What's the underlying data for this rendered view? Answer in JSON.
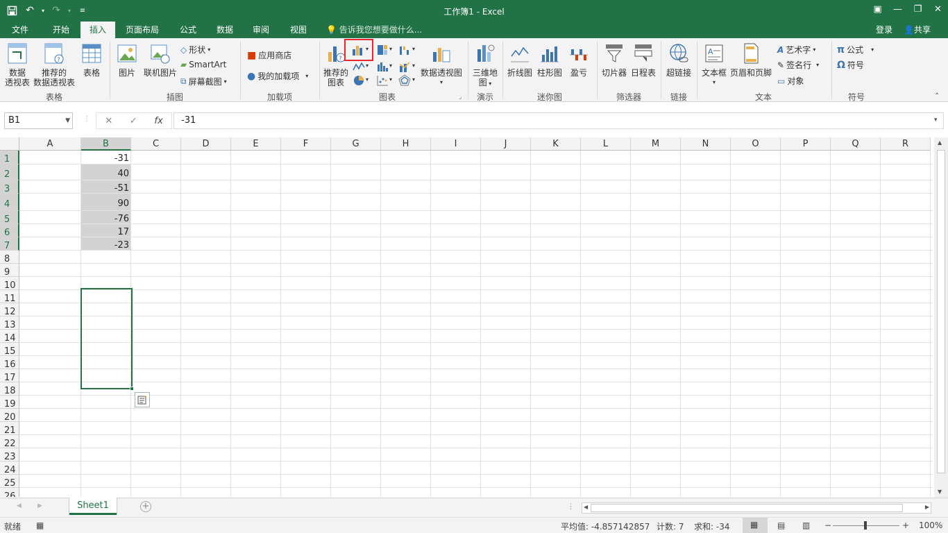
{
  "window": {
    "title": "工作簿1 - Excel"
  },
  "tabs": [
    {
      "label": "文件",
      "active": false
    },
    {
      "label": "开始",
      "active": false
    },
    {
      "label": "插入",
      "active": true
    },
    {
      "label": "页面布局",
      "active": false
    },
    {
      "label": "公式",
      "active": false
    },
    {
      "label": "数据",
      "active": false
    },
    {
      "label": "审阅",
      "active": false
    },
    {
      "label": "视图",
      "active": false
    }
  ],
  "tell_me": "告诉我您想要做什么...",
  "login": "登录",
  "share": "共享",
  "ribbon": {
    "pivot_line1": "数据",
    "pivot_line2": "透视表",
    "rec_pivot_line1": "推荐的",
    "rec_pivot_line2": "数据透视表",
    "table": "表格",
    "group_tables": "表格",
    "picture": "图片",
    "online_picture": "联机图片",
    "shapes": "形状",
    "smartart": "SmartArt",
    "screenshot": "屏幕截图",
    "group_illustrations": "插图",
    "store": "应用商店",
    "my_addins": "我的加载项",
    "group_addins": "加载项",
    "rec_chart_line1": "推荐的",
    "rec_chart_line2": "图表",
    "pivot_chart": "数据透视图",
    "group_charts": "图表",
    "map3d_line1": "三维地",
    "map3d_line2": "图",
    "group_tours": "演示",
    "spark_line": "折线图",
    "spark_column": "柱形图",
    "spark_winloss": "盈亏",
    "group_sparklines": "迷你图",
    "slicer": "切片器",
    "timeline": "日程表",
    "group_filters": "筛选器",
    "hyperlink": "超链接",
    "group_links": "链接",
    "textbox": "文本框",
    "header_footer": "页眉和页脚",
    "wordart": "艺术字",
    "signature": "签名行",
    "object": "对象",
    "group_text": "文本",
    "equation": "公式",
    "symbol": "符号",
    "group_symbols": "符号"
  },
  "formula": {
    "namebox": "B1",
    "fx": "fx",
    "value": "-31"
  },
  "columns": [
    "A",
    "B",
    "C",
    "D",
    "E",
    "F",
    "G",
    "H",
    "I",
    "J",
    "K",
    "L",
    "M",
    "N",
    "O",
    "P",
    "Q",
    "R"
  ],
  "rows": [
    "1",
    "2",
    "3",
    "4",
    "5",
    "6",
    "7",
    "8",
    "9",
    "10",
    "11",
    "12",
    "13",
    "14",
    "15",
    "16",
    "17",
    "18",
    "19",
    "20",
    "21",
    "22",
    "23",
    "24",
    "25",
    "26"
  ],
  "cells_B": [
    "-31",
    "40",
    "-51",
    "90",
    "-76",
    "17",
    "-23"
  ],
  "sheet": {
    "tab": "Sheet1"
  },
  "status": {
    "ready": "就绪",
    "average": "平均值: -4.857142857",
    "count": "计数: 7",
    "sum": "求和: -34",
    "zoom": "100%"
  },
  "colors": {
    "accent": "#217346",
    "highlight": "#e8262b",
    "selection": "#d3d3d3"
  }
}
